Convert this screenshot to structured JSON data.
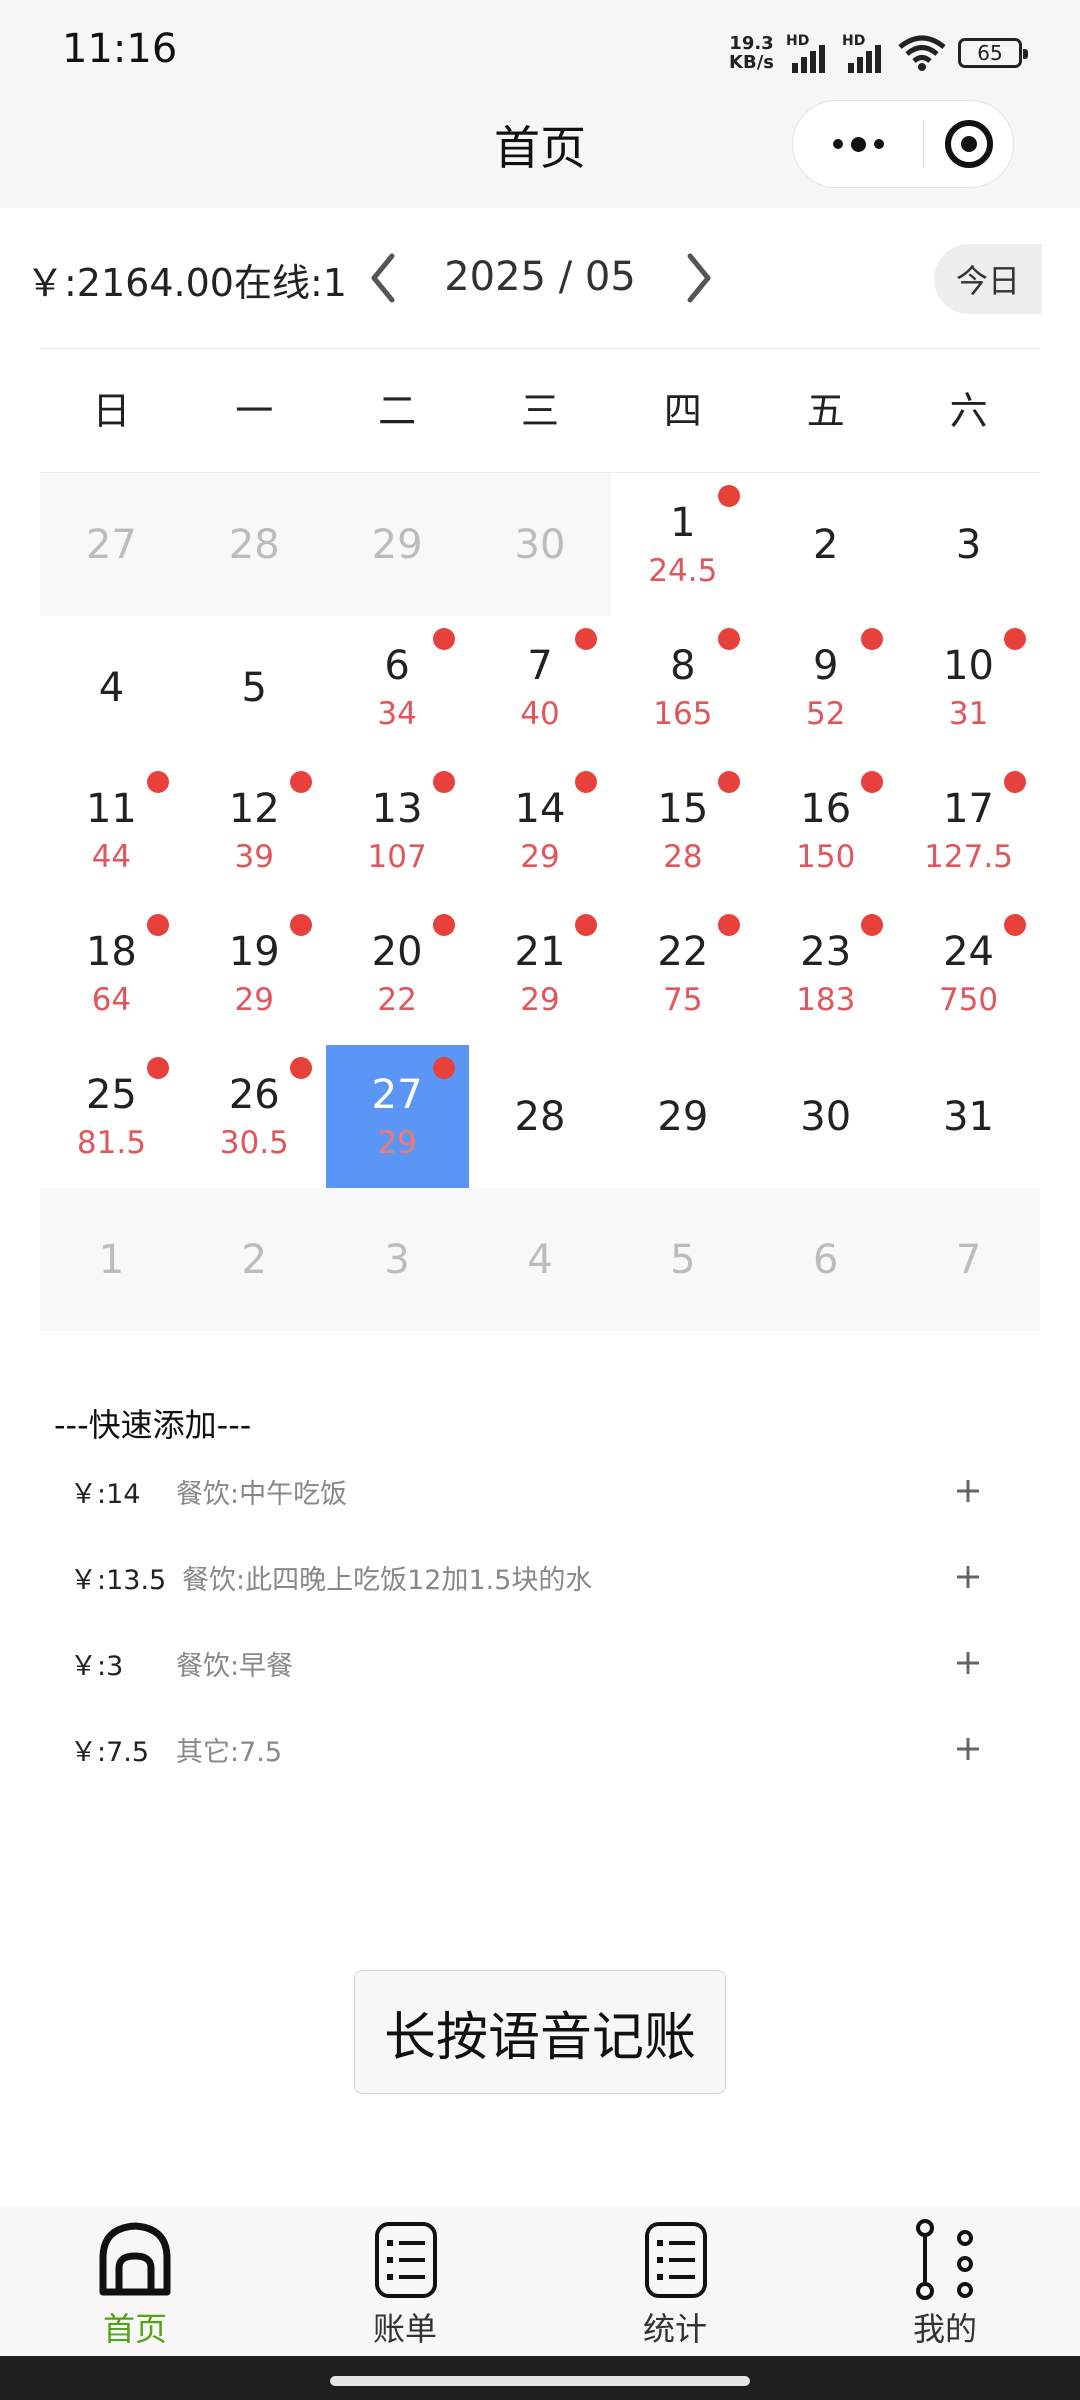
{
  "status_bar": {
    "time": "11:16",
    "net_speed_value": "19.3",
    "net_speed_unit": "KB/s",
    "hd_label_1": "HD",
    "hd_label_2": "HD",
    "battery": "65"
  },
  "header": {
    "title": "首页",
    "more_icon": "more-dots-icon",
    "close_icon": "target-circle-icon"
  },
  "toolbar": {
    "summary": "￥:2164.00在线:1",
    "month": "2025 / 05",
    "today_label": "今日"
  },
  "calendar": {
    "weekdays": [
      "日",
      "一",
      "二",
      "三",
      "四",
      "五",
      "六"
    ],
    "days": [
      {
        "day": "27",
        "amount": "",
        "other": true,
        "dot": false
      },
      {
        "day": "28",
        "amount": "",
        "other": true,
        "dot": false
      },
      {
        "day": "29",
        "amount": "",
        "other": true,
        "dot": false
      },
      {
        "day": "30",
        "amount": "",
        "other": true,
        "dot": false
      },
      {
        "day": "1",
        "amount": "24.5",
        "other": false,
        "dot": true
      },
      {
        "day": "2",
        "amount": "",
        "other": false,
        "dot": false
      },
      {
        "day": "3",
        "amount": "",
        "other": false,
        "dot": false
      },
      {
        "day": "4",
        "amount": "",
        "other": false,
        "dot": false
      },
      {
        "day": "5",
        "amount": "",
        "other": false,
        "dot": false
      },
      {
        "day": "6",
        "amount": "34",
        "other": false,
        "dot": true
      },
      {
        "day": "7",
        "amount": "40",
        "other": false,
        "dot": true
      },
      {
        "day": "8",
        "amount": "165",
        "other": false,
        "dot": true
      },
      {
        "day": "9",
        "amount": "52",
        "other": false,
        "dot": true
      },
      {
        "day": "10",
        "amount": "31",
        "other": false,
        "dot": true
      },
      {
        "day": "11",
        "amount": "44",
        "other": false,
        "dot": true
      },
      {
        "day": "12",
        "amount": "39",
        "other": false,
        "dot": true
      },
      {
        "day": "13",
        "amount": "107",
        "other": false,
        "dot": true
      },
      {
        "day": "14",
        "amount": "29",
        "other": false,
        "dot": true
      },
      {
        "day": "15",
        "amount": "28",
        "other": false,
        "dot": true
      },
      {
        "day": "16",
        "amount": "150",
        "other": false,
        "dot": true
      },
      {
        "day": "17",
        "amount": "127.5",
        "other": false,
        "dot": true
      },
      {
        "day": "18",
        "amount": "64",
        "other": false,
        "dot": true
      },
      {
        "day": "19",
        "amount": "29",
        "other": false,
        "dot": true
      },
      {
        "day": "20",
        "amount": "22",
        "other": false,
        "dot": true
      },
      {
        "day": "21",
        "amount": "29",
        "other": false,
        "dot": true
      },
      {
        "day": "22",
        "amount": "75",
        "other": false,
        "dot": true
      },
      {
        "day": "23",
        "amount": "183",
        "other": false,
        "dot": true
      },
      {
        "day": "24",
        "amount": "750",
        "other": false,
        "dot": true
      },
      {
        "day": "25",
        "amount": "81.5",
        "other": false,
        "dot": true
      },
      {
        "day": "26",
        "amount": "30.5",
        "other": false,
        "dot": true
      },
      {
        "day": "27",
        "amount": "29",
        "other": false,
        "dot": true,
        "selected": true
      },
      {
        "day": "28",
        "amount": "",
        "other": false,
        "dot": false
      },
      {
        "day": "29",
        "amount": "",
        "other": false,
        "dot": false
      },
      {
        "day": "30",
        "amount": "",
        "other": false,
        "dot": false
      },
      {
        "day": "31",
        "amount": "",
        "other": false,
        "dot": false
      },
      {
        "day": "1",
        "amount": "",
        "other": true,
        "dot": false
      },
      {
        "day": "2",
        "amount": "",
        "other": true,
        "dot": false
      },
      {
        "day": "3",
        "amount": "",
        "other": true,
        "dot": false
      },
      {
        "day": "4",
        "amount": "",
        "other": true,
        "dot": false
      },
      {
        "day": "5",
        "amount": "",
        "other": true,
        "dot": false
      },
      {
        "day": "6",
        "amount": "",
        "other": true,
        "dot": false
      },
      {
        "day": "7",
        "amount": "",
        "other": true,
        "dot": false
      }
    ],
    "colors": {
      "selected_bg": "#5b96f7",
      "amount": "#e0565a",
      "dot": "#e8403a"
    }
  },
  "quick_add": {
    "title": "---快速添加---",
    "items": [
      {
        "price": "￥:14",
        "desc": "餐饮:中午吃饭"
      },
      {
        "price": "￥:13.5",
        "desc": "餐饮:此四晚上吃饭12加1.5块的水"
      },
      {
        "price": "￥:3",
        "desc": "餐饮:早餐"
      },
      {
        "price": "￥:7.5",
        "desc": "其它:7.5"
      }
    ],
    "add_icon": "plus-icon"
  },
  "voice_button": {
    "label": "长按语音记账"
  },
  "tabbar": {
    "active_color": "#52a316",
    "items": [
      {
        "label": "首页",
        "icon": "home-icon",
        "active": true
      },
      {
        "label": "账单",
        "icon": "list-icon",
        "active": false
      },
      {
        "label": "统计",
        "icon": "list-icon",
        "active": false
      },
      {
        "label": "我的",
        "icon": "user-nodes-icon",
        "active": false
      }
    ]
  }
}
